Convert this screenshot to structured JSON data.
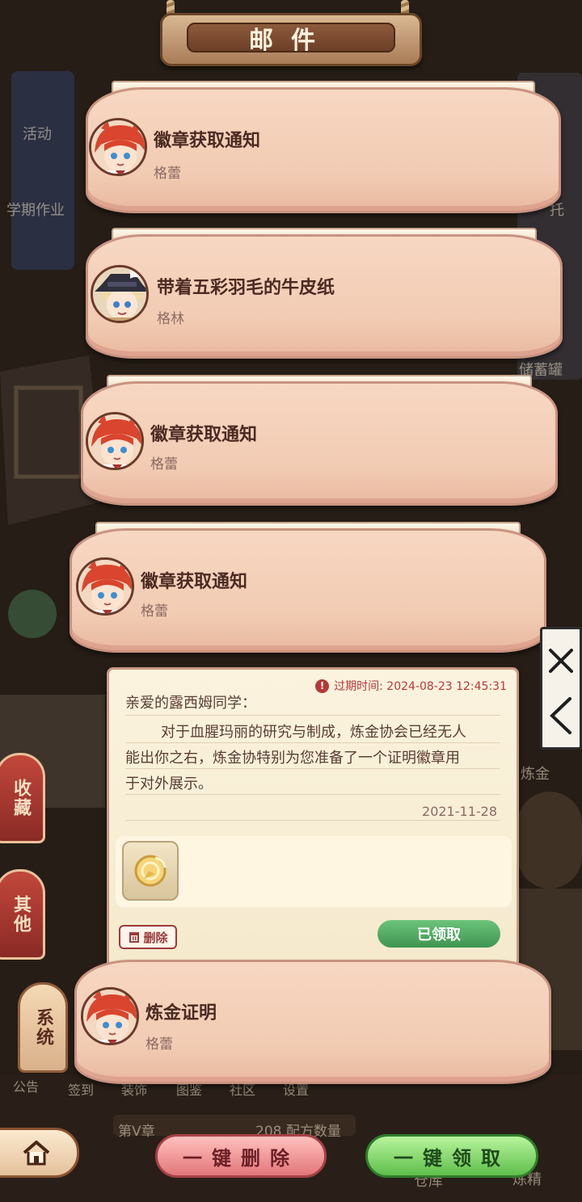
{
  "title": "邮件",
  "background_labels": {
    "activity": "活动",
    "homework": "学期作业",
    "storage_jar": "储蓄罐",
    "entrust": "托",
    "alchemy": "炼金",
    "chapter": "第V章",
    "recipe_count": "208 配方数量",
    "bottom_nav": [
      "公告",
      "签到",
      "装饰",
      "图鉴",
      "社区",
      "设置"
    ],
    "warehouse": "仓库",
    "refine": "炼精"
  },
  "mails": [
    {
      "title": "徽章获取通知",
      "sender": "格蕾",
      "avatar": "red-hair-girl-avatar"
    },
    {
      "title": "带着五彩羽毛的牛皮纸",
      "sender": "格林",
      "avatar": "hat-boy-avatar"
    },
    {
      "title": "徽章获取通知",
      "sender": "格蕾",
      "avatar": "red-hair-girl-avatar"
    },
    {
      "title": "徽章获取通知",
      "sender": "格蕾",
      "avatar": "red-hair-girl-avatar"
    }
  ],
  "open_mail": {
    "expire": "过期时间: 2024-08-23 12:45:31",
    "greeting": "亲爱的露西姆同学：",
    "body_lines": [
      "对于血腥玛丽的研究与制成，炼金协会已经无人",
      "能出你之右，炼金协特别为您准备了一个证明徽章用",
      "于对外展示。"
    ],
    "date": "2021-11-28",
    "attachment_icon": "gold-badge-icon",
    "delete_label": "删除",
    "claimed_label": "已领取",
    "footer_title": "炼金证明",
    "footer_sender": "格蕾"
  },
  "side_tabs": [
    {
      "label": "收藏",
      "active": false
    },
    {
      "label": "其他",
      "active": false
    },
    {
      "label": "系统",
      "active": true
    }
  ],
  "bottom": {
    "delete_all": "一键删除",
    "claim_all": "一键领取"
  },
  "colors": {
    "card_fill": "#f7d7c2",
    "card_border": "#c99381",
    "title_text": "#4b2a22",
    "expire_red": "#b5383a",
    "claimed_green": "#4fa862",
    "delete_pink": "#e3767a",
    "claim_green": "#5fbf4c"
  }
}
